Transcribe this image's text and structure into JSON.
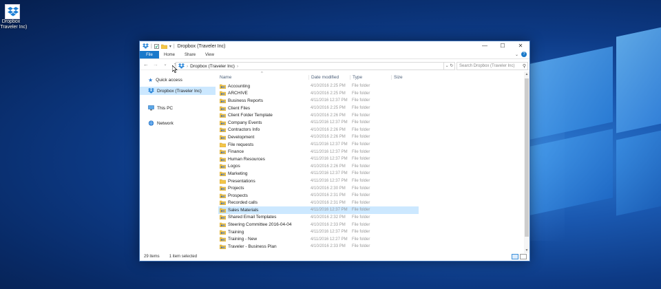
{
  "desktop": {
    "icon_label_line1": "Dropbox",
    "icon_label_line2": "(Traveler Inc)"
  },
  "window": {
    "title": "Dropbox (Traveler Inc)",
    "controls": {
      "minimize": "—",
      "maximize": "☐",
      "close": "✕"
    }
  },
  "ribbon": {
    "file": "File",
    "tabs": [
      "Home",
      "Share",
      "View"
    ],
    "expand": "⌄",
    "help": "?"
  },
  "address": {
    "back": "←",
    "forward": "→",
    "recent": "⌄",
    "up": "↑",
    "path": "Dropbox (Traveler Inc)",
    "separator": "›",
    "dropdown": "⌄",
    "refresh": "↻",
    "search_placeholder": "Search Dropbox (Traveler Inc)"
  },
  "nav_pane": [
    {
      "label": "Quick access",
      "icon": "star-icon"
    },
    {
      "label": "Dropbox (Traveler Inc)",
      "icon": "dropbox-icon"
    },
    {
      "label": "This PC",
      "icon": "computer-icon"
    },
    {
      "label": "Network",
      "icon": "network-icon"
    }
  ],
  "columns": {
    "name": "Name",
    "date": "Date modified",
    "type": "Type",
    "size": "Size",
    "sort_arrow": "^"
  },
  "files": [
    {
      "name": "Accounting",
      "date": "4/10/2016 2:25 PM",
      "type": "File folder"
    },
    {
      "name": "ARCHIVE",
      "date": "4/10/2016 2:25 PM",
      "type": "File folder"
    },
    {
      "name": "Business Reports",
      "date": "4/11/2016 12:37 PM",
      "type": "File folder"
    },
    {
      "name": "Client Files",
      "date": "4/10/2016 2:25 PM",
      "type": "File folder"
    },
    {
      "name": "Client Folder Template",
      "date": "4/10/2016 2:26 PM",
      "type": "File folder"
    },
    {
      "name": "Company Events",
      "date": "4/11/2016 12:37 PM",
      "type": "File folder"
    },
    {
      "name": "Contractors Info",
      "date": "4/10/2016 2:26 PM",
      "type": "File folder"
    },
    {
      "name": "Development",
      "date": "4/10/2016 2:26 PM",
      "type": "File folder"
    },
    {
      "name": "File requests",
      "date": "4/11/2016 12:37 PM",
      "type": "File folder"
    },
    {
      "name": "Finance",
      "date": "4/11/2016 12:37 PM",
      "type": "File folder"
    },
    {
      "name": "Human Resources",
      "date": "4/11/2016 12:37 PM",
      "type": "File folder"
    },
    {
      "name": "Logos",
      "date": "4/10/2016 2:26 PM",
      "type": "File folder"
    },
    {
      "name": "Marketing",
      "date": "4/11/2016 12:37 PM",
      "type": "File folder"
    },
    {
      "name": "Presentations",
      "date": "4/11/2016 12:37 PM",
      "type": "File folder"
    },
    {
      "name": "Projects",
      "date": "4/10/2016 2:30 PM",
      "type": "File folder"
    },
    {
      "name": "Prospects",
      "date": "4/10/2016 2:31 PM",
      "type": "File folder"
    },
    {
      "name": "Recorded calls",
      "date": "4/10/2016 2:31 PM",
      "type": "File folder"
    },
    {
      "name": "Sales Materials",
      "date": "4/11/2016 12:37 PM",
      "type": "File folder"
    },
    {
      "name": "Shared Email Templates",
      "date": "4/10/2016 2:32 PM",
      "type": "File folder"
    },
    {
      "name": "Steering Committee 2016-04-04",
      "date": "4/10/2016 2:33 PM",
      "type": "File folder"
    },
    {
      "name": "Training",
      "date": "4/11/2016 12:37 PM",
      "type": "File folder"
    },
    {
      "name": "Training - New",
      "date": "4/11/2016 12:27 PM",
      "type": "File folder"
    },
    {
      "name": "Traveler - Business Plan",
      "date": "4/10/2016 2:33 PM",
      "type": "File folder"
    }
  ],
  "selected_file": "Sales Materials",
  "status": {
    "items": "29 items",
    "selected": "1 item selected"
  },
  "colors": {
    "accent": "#1979ca",
    "selection": "#cce8ff",
    "desktop": "#0d3a85"
  }
}
